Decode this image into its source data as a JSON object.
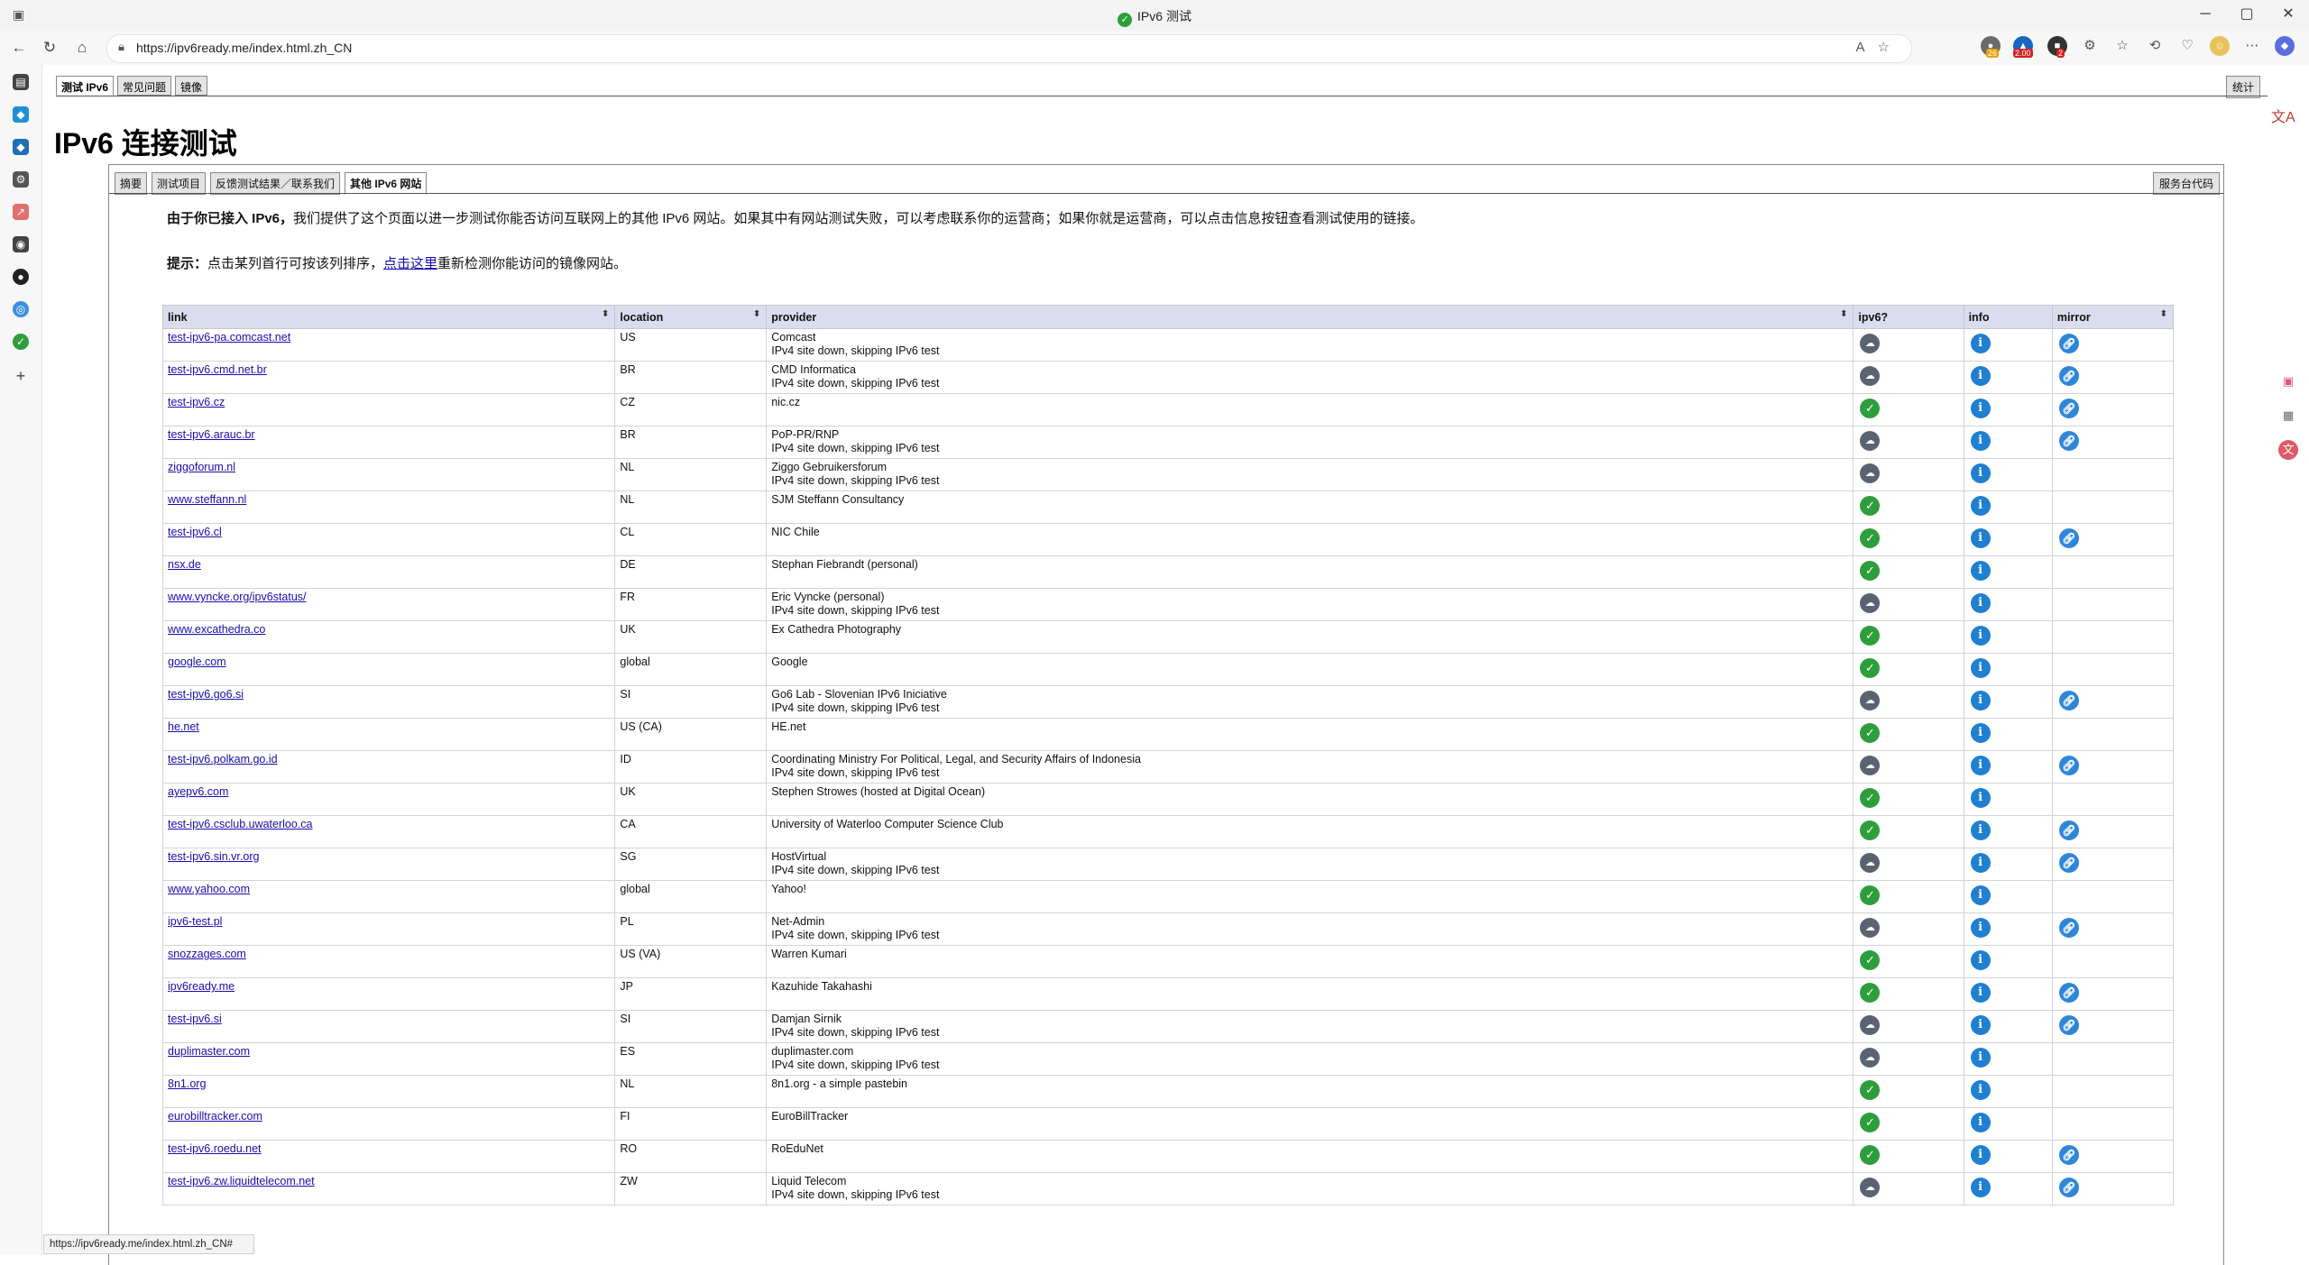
{
  "window": {
    "title": "IPv6 测试",
    "controls": {
      "minimize": "─",
      "maximize": "▢",
      "close": "✕"
    }
  },
  "browser": {
    "url": "https://ipv6ready.me/index.html.zh_CN",
    "status_url": "https://ipv6ready.me/index.html.zh_CN#",
    "extension_badges": {
      "badge1": "26",
      "badge2": "2.00",
      "badge3": "2"
    }
  },
  "page": {
    "top_tabs": [
      "测试 IPv6",
      "常见问题",
      "镜像"
    ],
    "stats_label": "统计",
    "title": "IPv6 连接测试",
    "sub_tabs": [
      "摘要",
      "测试项目",
      "反馈测试结果／联系我们",
      "其他 IPv6 网站"
    ],
    "helpdesk_label": "服务台代码",
    "intro_bold": "由于你已接入 IPv6，",
    "intro_rest": "我们提供了这个页面以进一步测试你能否访问互联网上的其他 IPv6 网站。如果其中有网站测试失败，可以考虑联系你的运营商；如果你就是运营商，可以点击信息按钮查看测试使用的链接。",
    "tip_bold": "提示：",
    "tip_pre": "点击某列首行可按该列排序，",
    "tip_link": "点击这里",
    "tip_post": "重新检测你能访问的镜像网站。"
  },
  "table": {
    "headers": {
      "link": "link",
      "location": "location",
      "provider": "provider",
      "ipv6": "ipv6?",
      "info": "info",
      "mirror": "mirror"
    },
    "rows": [
      {
        "link": "test-ipv6-pa.comcast.net",
        "location": "US",
        "provider": "Comcast",
        "note": "IPv4 site down, skipping IPv6 test",
        "status": "down",
        "mirror": true
      },
      {
        "link": "test-ipv6.cmd.net.br",
        "location": "BR",
        "provider": "CMD Informatica",
        "note": "IPv4 site down, skipping IPv6 test",
        "status": "down",
        "mirror": true
      },
      {
        "link": "test-ipv6.cz",
        "location": "CZ",
        "provider": "nic.cz",
        "note": "",
        "status": "ok",
        "mirror": true
      },
      {
        "link": "test-ipv6.arauc.br",
        "location": "BR",
        "provider": "PoP-PR/RNP",
        "note": "IPv4 site down, skipping IPv6 test",
        "status": "down",
        "mirror": true
      },
      {
        "link": "ziggoforum.nl",
        "location": "NL",
        "provider": "Ziggo Gebruikersforum",
        "note": "IPv4 site down, skipping IPv6 test",
        "status": "down",
        "mirror": false
      },
      {
        "link": "www.steffann.nl",
        "location": "NL",
        "provider": "SJM Steffann Consultancy",
        "note": "",
        "status": "ok",
        "mirror": false
      },
      {
        "link": "test-ipv6.cl",
        "location": "CL",
        "provider": "NIC Chile",
        "note": "",
        "status": "ok",
        "mirror": true
      },
      {
        "link": "nsx.de",
        "location": "DE",
        "provider": "Stephan Fiebrandt (personal)",
        "note": "",
        "status": "ok",
        "mirror": false
      },
      {
        "link": "www.vyncke.org/ipv6status/",
        "location": "FR",
        "provider": "Eric Vyncke (personal)",
        "note": "IPv4 site down, skipping IPv6 test",
        "status": "down",
        "mirror": false
      },
      {
        "link": "www.excathedra.co",
        "location": "UK",
        "provider": "Ex Cathedra Photography",
        "note": "",
        "status": "ok",
        "mirror": false
      },
      {
        "link": "google.com",
        "location": "global",
        "provider": "Google",
        "note": "",
        "status": "ok",
        "mirror": false
      },
      {
        "link": "test-ipv6.go6.si",
        "location": "SI",
        "provider": "Go6 Lab - Slovenian IPv6 Iniciative",
        "note": "IPv4 site down, skipping IPv6 test",
        "status": "down",
        "mirror": true
      },
      {
        "link": "he.net",
        "location": "US (CA)",
        "provider": "HE.net",
        "note": "",
        "status": "ok",
        "mirror": false
      },
      {
        "link": "test-ipv6.polkam.go.id",
        "location": "ID",
        "provider": "Coordinating Ministry For Political, Legal, and Security Affairs of Indonesia",
        "note": "IPv4 site down, skipping IPv6 test",
        "status": "down",
        "mirror": true
      },
      {
        "link": "ayepv6.com",
        "location": "UK",
        "provider": "Stephen Strowes (hosted at Digital Ocean)",
        "note": "",
        "status": "ok",
        "mirror": false
      },
      {
        "link": "test-ipv6.csclub.uwaterloo.ca",
        "location": "CA",
        "provider": "University of Waterloo Computer Science Club",
        "note": "",
        "status": "ok",
        "mirror": true
      },
      {
        "link": "test-ipv6.sin.vr.org",
        "location": "SG",
        "provider": "HostVirtual",
        "note": "IPv4 site down, skipping IPv6 test",
        "status": "down",
        "mirror": true
      },
      {
        "link": "www.yahoo.com",
        "location": "global",
        "provider": "Yahoo!",
        "note": "",
        "status": "ok",
        "mirror": false
      },
      {
        "link": "ipv6-test.pl",
        "location": "PL",
        "provider": "Net-Admin",
        "note": "IPv4 site down, skipping IPv6 test",
        "status": "down",
        "mirror": true
      },
      {
        "link": "snozzages.com",
        "location": "US (VA)",
        "provider": "Warren Kumari",
        "note": "",
        "status": "ok",
        "mirror": false
      },
      {
        "link": "ipv6ready.me",
        "location": "JP",
        "provider": "Kazuhide Takahashi",
        "note": "",
        "status": "ok",
        "mirror": true
      },
      {
        "link": "test-ipv6.si",
        "location": "SI",
        "provider": "Damjan Sirnik",
        "note": "IPv4 site down, skipping IPv6 test",
        "status": "down",
        "mirror": true
      },
      {
        "link": "duplimaster.com",
        "location": "ES",
        "provider": "duplimaster.com",
        "note": "IPv4 site down, skipping IPv6 test",
        "status": "down",
        "mirror": false
      },
      {
        "link": "8n1.org",
        "location": "NL",
        "provider": "8n1.org - a simple pastebin",
        "note": "",
        "status": "ok",
        "mirror": false
      },
      {
        "link": "eurobilltracker.com",
        "location": "FI",
        "provider": "EuroBillTracker",
        "note": "",
        "status": "ok",
        "mirror": false
      },
      {
        "link": "test-ipv6.roedu.net",
        "location": "RO",
        "provider": "RoEduNet",
        "note": "",
        "status": "ok",
        "mirror": true
      },
      {
        "link": "test-ipv6.zw.liquidtelecom.net",
        "location": "ZW",
        "provider": "Liquid Telecom",
        "note": "IPv4 site down, skipping IPv6 test",
        "status": "down",
        "mirror": true
      }
    ]
  },
  "colors": {
    "ok": "#2e9e3c",
    "down": "#5a6470",
    "info": "#1f7fd0",
    "mirror": "#2f86d9",
    "header_bg": "#dcdcf0"
  }
}
